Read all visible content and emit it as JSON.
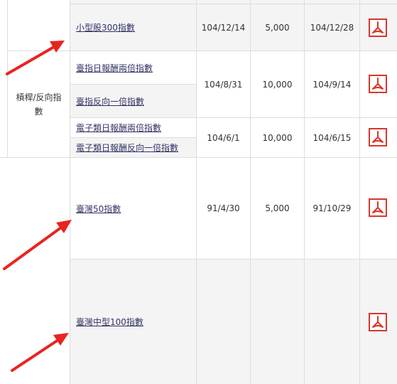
{
  "colors": {
    "border": "#dddddd",
    "row_shade": "#f4f4f4",
    "link": "#333366",
    "pdf_red": "#d9362b",
    "arrow_red": "#e8241f"
  },
  "category": {
    "leveraged_inverse": "槓桿/反向指數"
  },
  "rows": {
    "smallcap300": {
      "name": "小型股300指數",
      "date1": "104/12/14",
      "base": "5,000",
      "date2": "104/12/28"
    },
    "group_taiex_lev": {
      "name_a": "臺指日報酬兩倍指數",
      "name_b": "臺指反向一倍指數",
      "date1": "104/8/31",
      "base": "10,000",
      "date2": "104/9/14"
    },
    "group_elec_lev": {
      "name_a": "電子類日報酬兩倍指數",
      "name_b": "電子類日報酬反向一倍指數",
      "date1": "104/6/1",
      "base": "10,000",
      "date2": "104/6/15"
    },
    "taiwan50": {
      "name": "臺灣50指數",
      "date1": "91/4/30",
      "base": "5,000",
      "date2": "91/10/29"
    },
    "midcap100": {
      "name": "臺灣中型100指數",
      "date1": "",
      "base": "",
      "date2": ""
    }
  },
  "icons": {
    "pdf": "pdf-file-icon",
    "arrow": "red-pointer-arrow"
  }
}
